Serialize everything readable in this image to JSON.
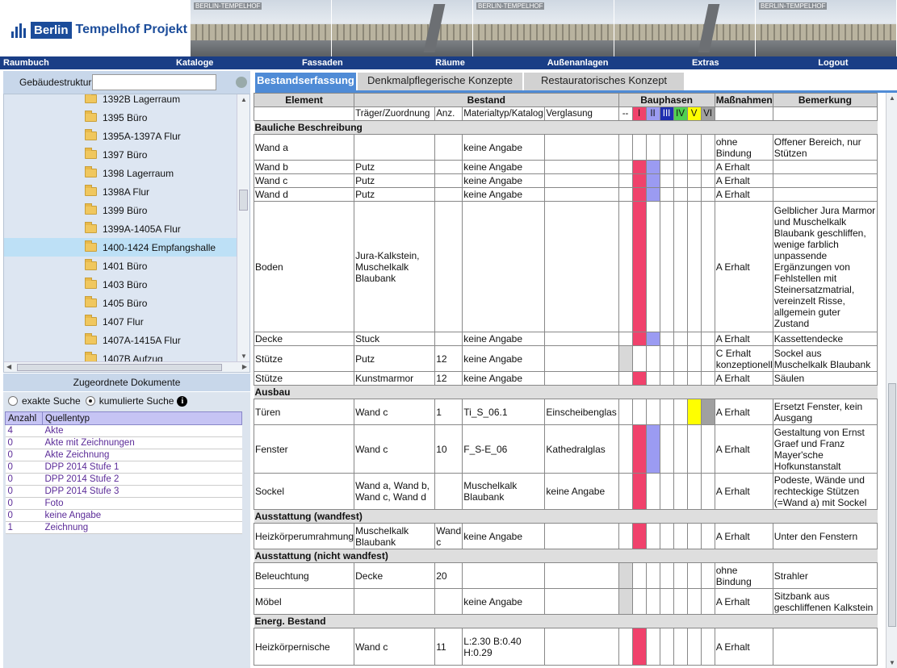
{
  "logo": {
    "berlin": "Berlin",
    "project": "Tempelhof Projekt"
  },
  "banner": {
    "tag": "BERLIN-TEMPELHOF"
  },
  "nav": [
    "Raumbuch",
    "Kataloge",
    "Fassaden",
    "Räume",
    "Außenanlagen",
    "Extras",
    "Logout"
  ],
  "sidebar": {
    "structure_label": "Gebäudestruktur",
    "structure_input": "",
    "tree": [
      "1392B Lagerraum",
      "1395 Büro",
      "1395A-1397A Flur",
      "1397 Büro",
      "1398 Lagerraum",
      "1398A Flur",
      "1399 Büro",
      "1399A-1405A Flur",
      "1400-1424 Empfangshalle",
      "1401 Büro",
      "1403 Büro",
      "1405 Büro",
      "1407 Flur",
      "1407A-1415A Flur",
      "1407B Aufzug"
    ],
    "selected": "1400-1424 Empfangshalle",
    "docs_title": "Zugeordnete Dokumente",
    "search_exact": "exakte Suche",
    "search_cumulative": "kumulierte Suche",
    "sources_headers": [
      "Anzahl",
      "Quellentyp"
    ],
    "sources": [
      {
        "count": "4",
        "type": "Akte"
      },
      {
        "count": "0",
        "type": "Akte mit Zeichnungen"
      },
      {
        "count": "0",
        "type": "Akte Zeichnung"
      },
      {
        "count": "0",
        "type": "DPP 2014 Stufe 1"
      },
      {
        "count": "0",
        "type": "DPP 2014 Stufe 2"
      },
      {
        "count": "0",
        "type": "DPP 2014 Stufe 3"
      },
      {
        "count": "0",
        "type": "Foto"
      },
      {
        "count": "0",
        "type": "keine Angabe"
      },
      {
        "count": "1",
        "type": "Zeichnung"
      }
    ]
  },
  "tabs": [
    "Bestandserfassung",
    "Denkmalpflegerische Konzepte",
    "Restauratorisches Konzept"
  ],
  "table": {
    "headers": {
      "element": "Element",
      "bestand": "Bestand",
      "bauphasen": "Bauphasen",
      "massnahmen": "Maßnahmen",
      "bemerkung": "Bemerkung"
    },
    "subheaders": [
      "Träger/Zuordnung",
      "Anz.",
      "Materialtyp/Katalog",
      "Verglasung"
    ],
    "phases": [
      "--",
      "I",
      "II",
      "III",
      "IV",
      "V",
      "VI"
    ],
    "phase_colors": [
      "#d8d8d8",
      "#f0426c",
      "#9b9bf2",
      "#1f2fb0",
      "#50d050",
      "#ffff00",
      "#a0a0a0"
    ],
    "sections": [
      {
        "title": "Bauliche Beschreibung",
        "rows": [
          {
            "element": "Wand a",
            "traeger": "",
            "anz": "",
            "material": "keine Angabe",
            "verglasung": "",
            "phases": [],
            "massnahmen": "ohne Bindung",
            "bemerkung": "Offener Bereich, nur Stützen"
          },
          {
            "element": "Wand b",
            "traeger": "Putz",
            "anz": "",
            "material": "keine Angabe",
            "verglasung": "",
            "phases": [
              1,
              2
            ],
            "massnahmen": "A Erhalt",
            "bemerkung": ""
          },
          {
            "element": "Wand c",
            "traeger": "Putz",
            "anz": "",
            "material": "keine Angabe",
            "verglasung": "",
            "phases": [
              1,
              2
            ],
            "massnahmen": "A Erhalt",
            "bemerkung": ""
          },
          {
            "element": "Wand d",
            "traeger": "Putz",
            "anz": "",
            "material": "keine Angabe",
            "verglasung": "",
            "phases": [
              1,
              2
            ],
            "massnahmen": "A Erhalt",
            "bemerkung": ""
          },
          {
            "element": "Boden",
            "traeger": "Jura-Kalkstein, Muschelkalk Blaubank",
            "anz": "",
            "material": "",
            "verglasung": "",
            "phases": [
              1
            ],
            "massnahmen": "A Erhalt",
            "bemerkung": "Gelblicher Jura Marmor und Muschelkalk Blaubank geschliffen, wenige farblich unpassende Ergänzungen von Fehlstellen mit Steinersatzmatrial, vereinzelt Risse, allgemein guter Zustand"
          },
          {
            "element": "Decke",
            "traeger": "Stuck",
            "anz": "",
            "material": "keine Angabe",
            "verglasung": "",
            "phases": [
              1,
              2
            ],
            "massnahmen": "A Erhalt",
            "bemerkung": "Kassettendecke"
          },
          {
            "element": "Stütze",
            "traeger": "Putz",
            "anz": "12",
            "material": "keine Angabe",
            "verglasung": "",
            "phases": [
              0
            ],
            "massnahmen": "C Erhalt konzeptionell",
            "bemerkung": "Sockel aus Muschelkalk Blaubank"
          },
          {
            "element": "Stütze",
            "traeger": "Kunstmarmor",
            "anz": "12",
            "material": "keine Angabe",
            "verglasung": "",
            "phases": [
              1
            ],
            "massnahmen": "A Erhalt",
            "bemerkung": "Säulen"
          }
        ]
      },
      {
        "title": "Ausbau",
        "rows": [
          {
            "element": "Türen",
            "traeger": "Wand c",
            "anz": "1",
            "material": "Ti_S_06.1",
            "verglasung": "Einscheibenglas",
            "phases": [
              5,
              6
            ],
            "massnahmen": "A Erhalt",
            "bemerkung": "Ersetzt Fenster, kein Ausgang"
          },
          {
            "element": "Fenster",
            "traeger": "Wand c",
            "anz": "10",
            "material": "F_S-E_06",
            "verglasung": "Kathedralglas",
            "phases": [
              1,
              2
            ],
            "massnahmen": "A Erhalt",
            "bemerkung": "Gestaltung von Ernst Graef und Franz Mayer'sche Hofkunstanstalt"
          },
          {
            "element": "Sockel",
            "traeger": "Wand a, Wand b, Wand c, Wand d",
            "anz": "",
            "material": "Muschelkalk Blaubank",
            "verglasung": "keine Angabe",
            "phases": [
              1
            ],
            "massnahmen": "A Erhalt",
            "bemerkung": "Podeste, Wände und rechteckige Stützen (=Wand a) mit Sockel"
          }
        ]
      },
      {
        "title": "Ausstattung (wandfest)",
        "rows": [
          {
            "element": "Heizkörperumrahmung",
            "traeger": "Muschelkalk Blaubank",
            "anz": "Wand c",
            "material": "keine Angabe",
            "verglasung": "",
            "phases": [
              1
            ],
            "massnahmen": "A Erhalt",
            "bemerkung": "Unter den Fenstern"
          }
        ]
      },
      {
        "title": "Ausstattung (nicht wandfest)",
        "rows": [
          {
            "element": "Beleuchtung",
            "traeger": "Decke",
            "anz": "20",
            "material": "",
            "verglasung": "",
            "phases": [
              0
            ],
            "massnahmen": "ohne Bindung",
            "bemerkung": "Strahler"
          },
          {
            "element": "Möbel",
            "traeger": "",
            "anz": "",
            "material": "keine Angabe",
            "verglasung": "",
            "phases": [
              0
            ],
            "massnahmen": "A Erhalt",
            "bemerkung": "Sitzbank aus geschliffenen Kalkstein"
          }
        ]
      },
      {
        "title": "Energ. Bestand",
        "rows": [
          {
            "element": "Heizkörpernische",
            "traeger": "Wand c",
            "anz": "11",
            "material": "L:2.30 B:0.40 H:0.29",
            "verglasung": "",
            "phases": [
              1
            ],
            "massnahmen": "A Erhalt",
            "bemerkung": ""
          }
        ]
      }
    ]
  }
}
